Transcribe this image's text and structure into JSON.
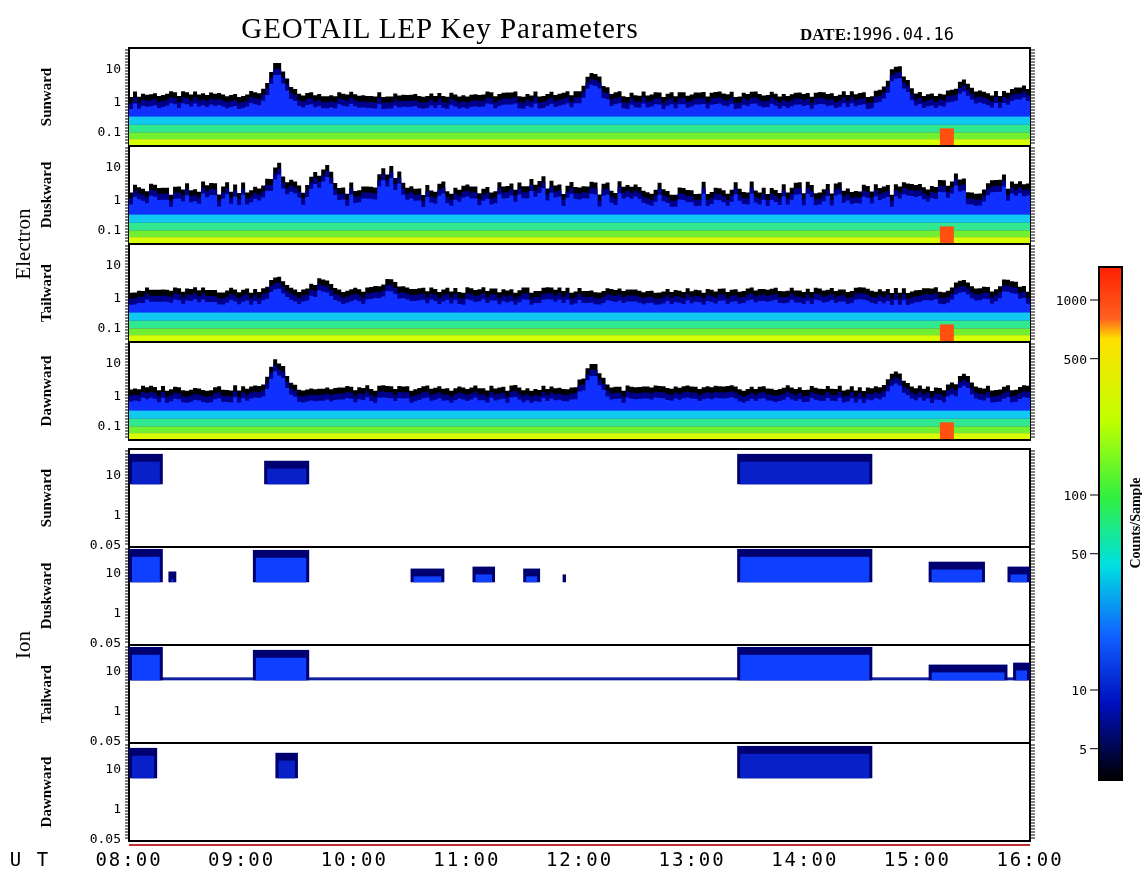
{
  "title": "GEOTAIL LEP Key Parameters",
  "date": {
    "label": "DATE:",
    "value": "1996.04.16"
  },
  "groups": [
    {
      "name": "Electron",
      "kind": "electron",
      "panels": [
        {
          "direction": "Sunward",
          "yticks": [
            "10",
            "1",
            "0.1"
          ]
        },
        {
          "direction": "Duskward",
          "yticks": [
            "10",
            "1",
            "0.1"
          ]
        },
        {
          "direction": "Tailward",
          "yticks": [
            "10",
            "1",
            "0.1"
          ]
        },
        {
          "direction": "Dawnward",
          "yticks": [
            "10",
            "1",
            "0.1"
          ]
        }
      ]
    },
    {
      "name": "Ion",
      "kind": "ion",
      "panels": [
        {
          "direction": "Sunward",
          "yticks": [
            "10",
            "1",
            "0.05"
          ]
        },
        {
          "direction": "Duskward",
          "yticks": [
            "10",
            "1",
            "0.05"
          ]
        },
        {
          "direction": "Tailward",
          "yticks": [
            "10",
            "1",
            "0.05"
          ]
        },
        {
          "direction": "Dawnward",
          "yticks": [
            "10",
            "1",
            "0.05"
          ]
        }
      ]
    }
  ],
  "colorbar": {
    "label": "Counts/Sample",
    "ticks": [
      "1000",
      "500",
      "100",
      "50",
      "10",
      "5"
    ]
  },
  "x_axis": {
    "label": "U T",
    "ticks": [
      "08:00",
      "09:00",
      "10:00",
      "11:00",
      "12:00",
      "13:00",
      "14:00",
      "15:00",
      "16:00"
    ]
  }
}
